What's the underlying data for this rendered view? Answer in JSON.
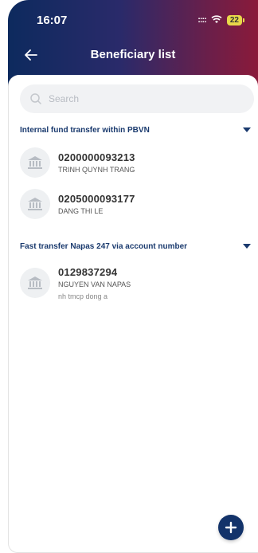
{
  "status": {
    "time": "16:07",
    "battery": "22",
    "signal": "::::"
  },
  "nav": {
    "title": "Beneficiary list"
  },
  "search": {
    "placeholder": "Search"
  },
  "sections": [
    {
      "title": "Internal fund transfer within PBVN",
      "items": [
        {
          "account": "0200000093213",
          "name": "TRINH QUYNH TRANG"
        },
        {
          "account": "0205000093177",
          "name": "DANG THI LE"
        }
      ]
    },
    {
      "title": "Fast transfer Napas 247 via account number",
      "items": [
        {
          "account": "0129837294",
          "name": "NGUYEN VAN NAPAS",
          "bank": "nh tmcp dong a"
        }
      ]
    }
  ],
  "colors": {
    "accent": "#1a3a6e",
    "fab": "#13336a",
    "header_left": "#0d2a5e",
    "header_right": "#8a1a3a"
  },
  "icons": {
    "back": "arrow-left-icon",
    "search": "search-icon",
    "bank": "bank-icon",
    "add": "plus-icon"
  }
}
